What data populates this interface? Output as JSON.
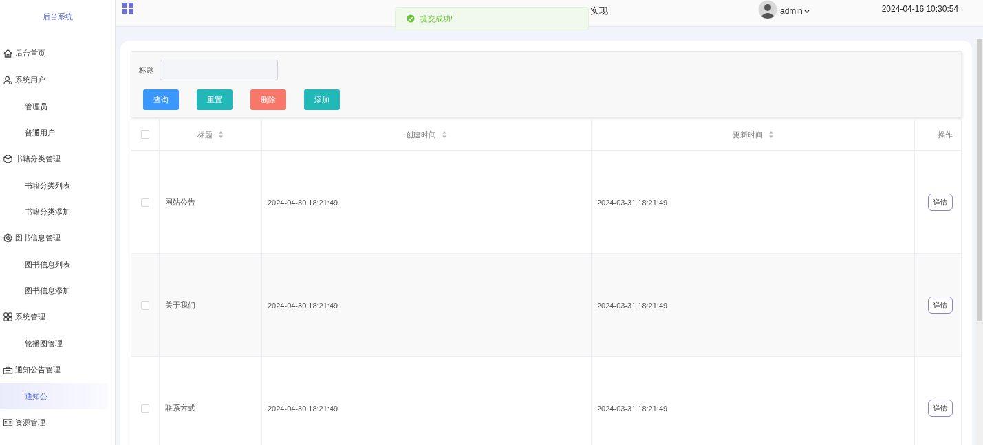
{
  "sidebar": {
    "title": "后台系统",
    "menu": [
      {
        "label": "后台首页",
        "selected": false
      },
      {
        "label": "系统用户",
        "selected": false,
        "children": [
          {
            "label": "管理员",
            "selected": false
          },
          {
            "label": "普通用户",
            "selected": false
          }
        ]
      },
      {
        "label": "书籍分类管理",
        "selected": false,
        "children": [
          {
            "label": "书籍分类列表",
            "selected": false
          },
          {
            "label": "书籍分类添加",
            "selected": false
          }
        ]
      },
      {
        "label": "图书信息管理",
        "selected": false,
        "children": [
          {
            "label": "图书信息列表",
            "selected": false
          },
          {
            "label": "图书信息添加",
            "selected": false
          }
        ]
      },
      {
        "label": "系统管理",
        "selected": false,
        "children": [
          {
            "label": "轮播图管理",
            "selected": false
          }
        ]
      },
      {
        "label": "通知公告管理",
        "selected": false,
        "children": [
          {
            "label": "通知公",
            "selected": true
          }
        ]
      },
      {
        "label": "资源管理",
        "selected": false
      }
    ]
  },
  "header": {
    "title": "实现",
    "user": "admin",
    "datetime": "2024-04-16 10:30:54"
  },
  "toast": {
    "message": "提交成功!"
  },
  "search": {
    "label": "标题",
    "buttons": [
      {
        "label": "查询",
        "kind": "primary"
      },
      {
        "label": "重置",
        "kind": "reset"
      },
      {
        "label": "删除",
        "kind": "danger"
      },
      {
        "label": "添加",
        "kind": "add"
      }
    ]
  },
  "table": {
    "columns": [
      {
        "label": "标题",
        "sortable": true
      },
      {
        "label": "创建时间",
        "sortable": true
      },
      {
        "label": "更新时间",
        "sortable": true
      },
      {
        "label": "操作",
        "sortable": false
      }
    ],
    "header_checked": false,
    "rows": [
      {
        "checked": false,
        "title": "网站公告",
        "created": "2024-04-30 18:21:49",
        "updated": "2024-03-31 18:21:49",
        "action": "详情"
      },
      {
        "checked": false,
        "title": "关于我们",
        "created": "2024-04-30 18:21:49",
        "updated": "2024-03-31 18:21:49",
        "action": "详情"
      },
      {
        "checked": false,
        "title": "联系方式",
        "created": "2024-04-30 18:21:49",
        "updated": "2024-03-31 18:21:49",
        "action": "详情"
      }
    ]
  }
}
